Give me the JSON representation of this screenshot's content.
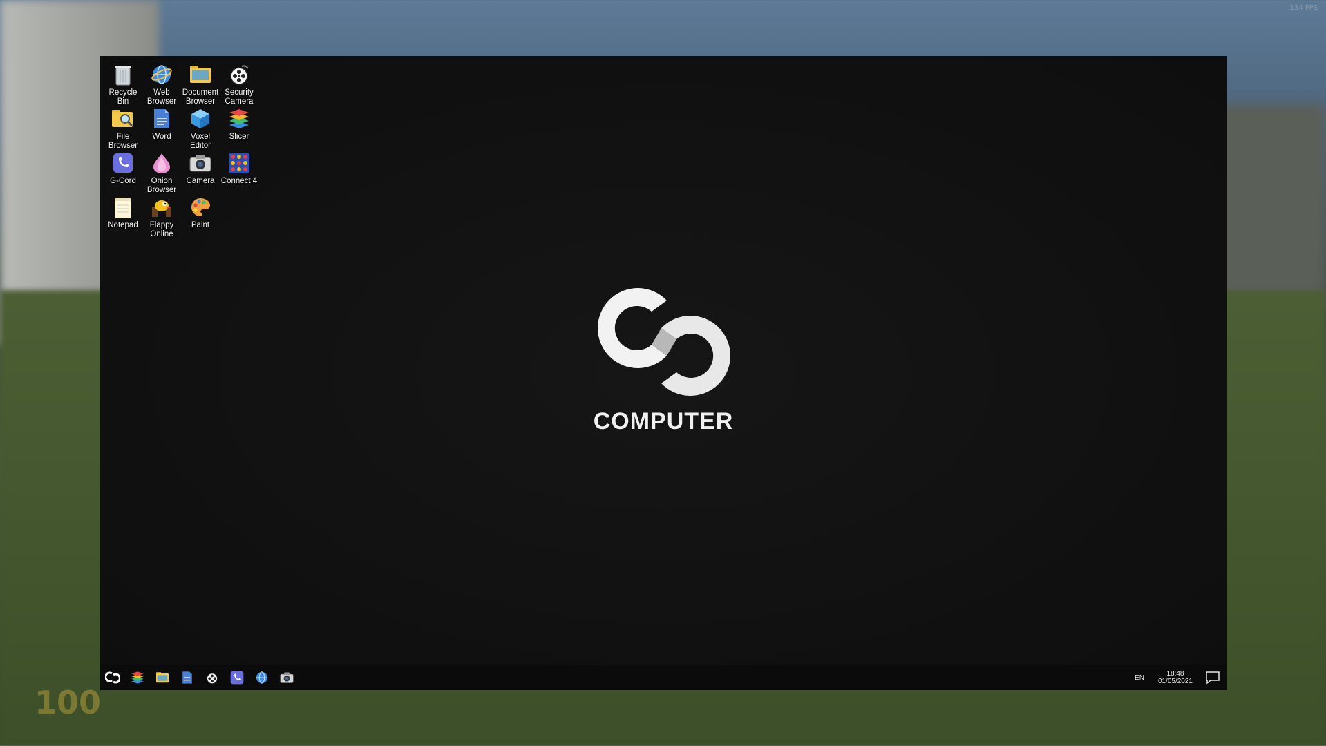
{
  "overlay": {
    "fps_text": "134 FPS",
    "hud_value": "100"
  },
  "desktop": {
    "icons": [
      {
        "label": "Recycle Bin",
        "icon": "recycle-bin-icon"
      },
      {
        "label": "Web Browser",
        "icon": "globe-icon"
      },
      {
        "label": "Document Browser",
        "icon": "folder-icon"
      },
      {
        "label": "Security Camera",
        "icon": "film-reel-icon"
      },
      {
        "label": "File Browser",
        "icon": "folder-search-icon"
      },
      {
        "label": "Word",
        "icon": "document-icon"
      },
      {
        "label": "Voxel Editor",
        "icon": "cube-icon"
      },
      {
        "label": "Slicer",
        "icon": "layers-icon"
      },
      {
        "label": "G-Cord",
        "icon": "phone-icon"
      },
      {
        "label": "Onion Browser",
        "icon": "onion-icon"
      },
      {
        "label": "Camera",
        "icon": "camera-icon"
      },
      {
        "label": "Connect 4",
        "icon": "grid-icon"
      },
      {
        "label": "Notepad",
        "icon": "notepad-icon"
      },
      {
        "label": "Flappy Online",
        "icon": "flappy-icon"
      },
      {
        "label": "Paint",
        "icon": "palette-icon"
      }
    ]
  },
  "logo": {
    "text": "COMPUTER"
  },
  "taskbar": {
    "items": [
      "start-logo-icon",
      "layers-icon",
      "folder-icon",
      "document-icon",
      "film-reel-icon",
      "phone-icon",
      "globe-icon",
      "camera-icon"
    ],
    "language": "EN",
    "time": "18:48",
    "date": "01/05/2021"
  },
  "colors": {
    "screen_bg": "#111111",
    "taskbar_bg": "#0b0b0b",
    "accent_blue": "#4a7fd8"
  }
}
